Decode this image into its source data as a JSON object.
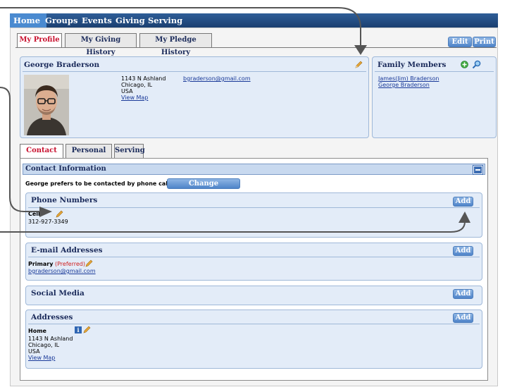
{
  "topnav": {
    "items": [
      "Home",
      "Groups",
      "Events",
      "Giving",
      "Serving"
    ]
  },
  "profile_tabs": [
    "My Profile",
    "My Giving History",
    "My Pledge History"
  ],
  "actions": {
    "edit": "Edit",
    "print": "Print"
  },
  "person": {
    "name": "George Braderson",
    "address_line1": "1143 N Ashland",
    "address_line2": "Chicago, IL",
    "address_line3": "USA",
    "view_map": "View Map",
    "email": "bgraderson@gmail.com"
  },
  "family": {
    "title": "Family Members",
    "members": [
      "James(Jim) Braderson",
      "George Braderson"
    ]
  },
  "info_tabs": [
    "Contact Info",
    "Personal Info",
    "Serving"
  ],
  "contact": {
    "title": "Contact Information",
    "preference_text": "George prefers to be contacted by phone call.",
    "change_pref_button": "Change Preference",
    "phone": {
      "title": "Phone Numbers",
      "add": "Add",
      "type": "Cell",
      "number": "312-927-3349"
    },
    "email": {
      "title": "E-mail Addresses",
      "add": "Add",
      "type": "Primary",
      "preferred": "(Preferred)",
      "address": "bgraderson@gmail.com"
    },
    "social": {
      "title": "Social Media",
      "add": "Add"
    },
    "addresses": {
      "title": "Addresses",
      "add": "Add",
      "type": "Home",
      "line1": "1143 N Ashland",
      "line2": "Chicago, IL",
      "line3": "USA",
      "view_map": "View Map"
    }
  },
  "icons": [
    "pencil-icon",
    "add-icon",
    "search-icon",
    "info-icon",
    "collapse-icon",
    "arrow-icon"
  ],
  "colors": {
    "nav_bg": "#1b3f70",
    "active_tab": "#c8102e",
    "panel_bg": "#e3ecf8",
    "button_blue": "#4f84c9"
  }
}
